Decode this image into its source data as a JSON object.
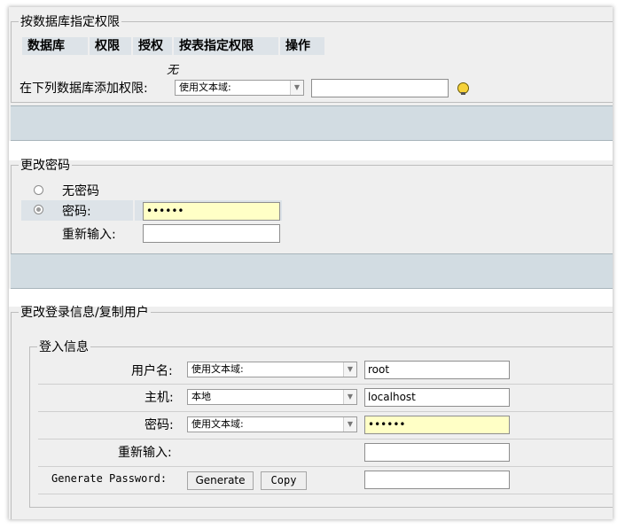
{
  "db_privileges": {
    "legend": "按数据库指定权限",
    "headers": [
      "数据库",
      "权限",
      "授权",
      "按表指定权限",
      "操作"
    ],
    "empty_note": "无",
    "add_label": "在下列数据库添加权限:",
    "select_value": "使用文本域:",
    "text_value": "",
    "hint_icon": "lightbulb-icon"
  },
  "change_password": {
    "legend": "更改密码",
    "no_password_label": "无密码",
    "password_label": "密码:",
    "password_value": "••••••",
    "reenter_label": "重新输入:",
    "reenter_value": "",
    "selected": "password"
  },
  "change_login": {
    "legend": "更改登录信息/复制用户",
    "login_info": {
      "legend": "登入信息",
      "username_label": "用户名:",
      "username_select": "使用文本域:",
      "username_value": "root",
      "host_label": "主机:",
      "host_select": "本地",
      "host_value": "localhost",
      "password_label": "密码:",
      "password_select": "使用文本域:",
      "password_value": "••••••",
      "reenter_label": "重新输入:",
      "reenter_value": "",
      "generate_label": "Generate Password:",
      "generate_button": "Generate",
      "copy_button": "Copy",
      "generated_value": ""
    }
  },
  "colors": {
    "panel_bg": "#efefef",
    "band": "#d2dce2",
    "header_bg": "#dde3e8",
    "highlight_input": "#ffffc6"
  }
}
